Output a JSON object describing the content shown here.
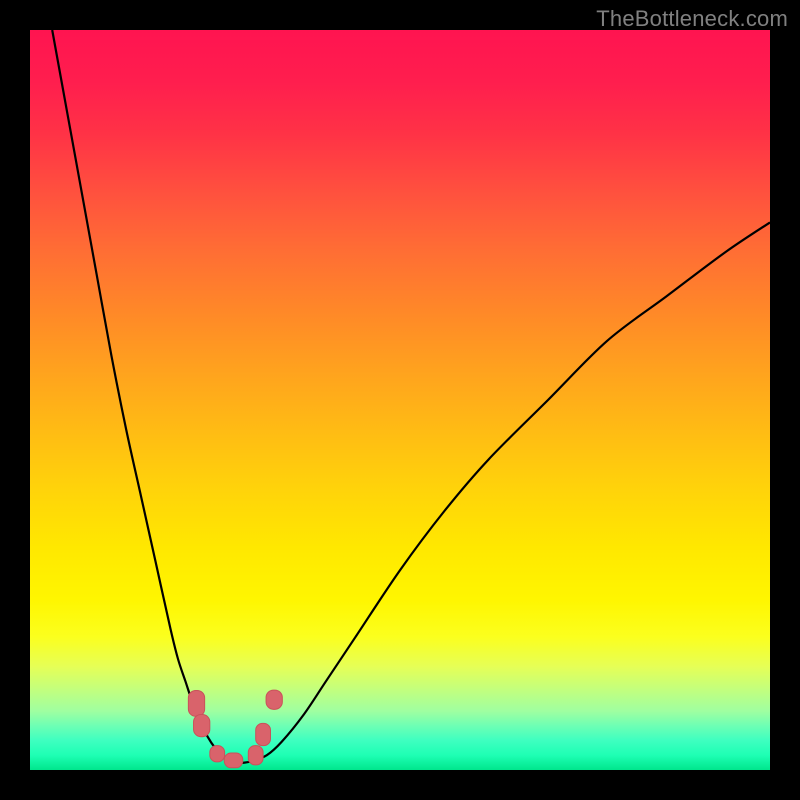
{
  "watermark": "TheBottleneck.com",
  "colors": {
    "frame": "#000000",
    "watermark": "#808080",
    "curve": "#000000",
    "marker_fill": "#d9636b",
    "marker_stroke": "#c9525a"
  },
  "chart_data": {
    "type": "line",
    "title": "",
    "xlabel": "",
    "ylabel": "",
    "xlim": [
      0,
      100
    ],
    "ylim": [
      0,
      100
    ],
    "grid": false,
    "legend": false,
    "series": [
      {
        "name": "bottleneck-curve",
        "x": [
          3,
          5,
          7,
          9,
          11,
          13,
          15,
          17,
          19,
          20,
          21,
          22,
          23,
          24,
          25,
          26,
          27,
          28,
          29,
          30,
          32,
          34,
          37,
          40,
          44,
          50,
          56,
          62,
          70,
          78,
          86,
          94,
          100
        ],
        "y": [
          100,
          89,
          78,
          67,
          56,
          46,
          37,
          28,
          19,
          15,
          12,
          9,
          6.5,
          4.5,
          3,
          2,
          1.4,
          1,
          1,
          1.2,
          2,
          3.8,
          7.5,
          12,
          18,
          27,
          35,
          42,
          50,
          58,
          64,
          70,
          74
        ]
      }
    ],
    "markers": [
      {
        "x": 22.5,
        "y": 9,
        "w": 2.2,
        "h": 3.5
      },
      {
        "x": 23.2,
        "y": 6,
        "w": 2.2,
        "h": 3.0
      },
      {
        "x": 25.3,
        "y": 2.2,
        "w": 2.0,
        "h": 2.2
      },
      {
        "x": 27.5,
        "y": 1.3,
        "w": 2.5,
        "h": 2.0
      },
      {
        "x": 30.5,
        "y": 2.0,
        "w": 2.0,
        "h": 2.6
      },
      {
        "x": 31.5,
        "y": 4.8,
        "w": 2.0,
        "h": 3.0
      },
      {
        "x": 33.0,
        "y": 9.5,
        "w": 2.2,
        "h": 2.6
      }
    ],
    "background_gradient": {
      "top": "#ff1450",
      "bottom": "#00e68c"
    }
  }
}
